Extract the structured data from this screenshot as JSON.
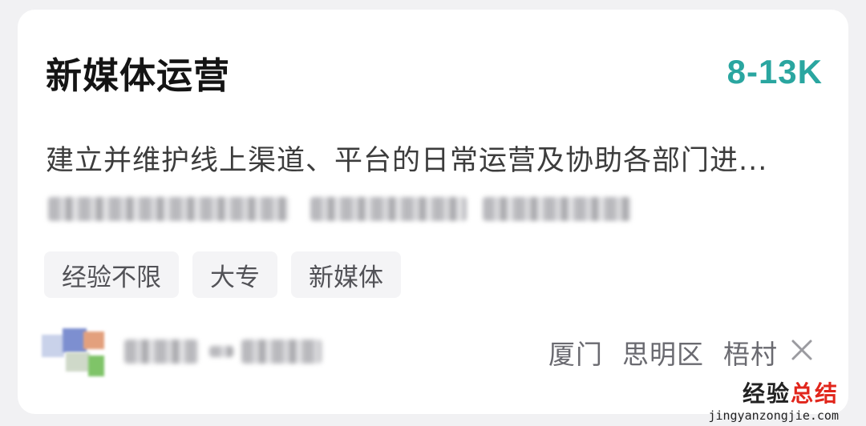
{
  "job": {
    "title": "新媒体运营",
    "salary": "8-13K",
    "description": "建立并维护线上渠道、平台的日常运营及协助各部门进..."
  },
  "tags": [
    "经验不限",
    "大专",
    "新媒体"
  ],
  "location": {
    "city": "厦门",
    "district": "思明区",
    "area": "梧村"
  },
  "watermark": {
    "text_a": "经验",
    "text_b": "总结",
    "url": "jingyanzongjie.com"
  },
  "colors": {
    "salary": "#2aa6a0",
    "watermark_accent": "#e1261c"
  },
  "icons": {
    "dismiss": "close-icon"
  }
}
